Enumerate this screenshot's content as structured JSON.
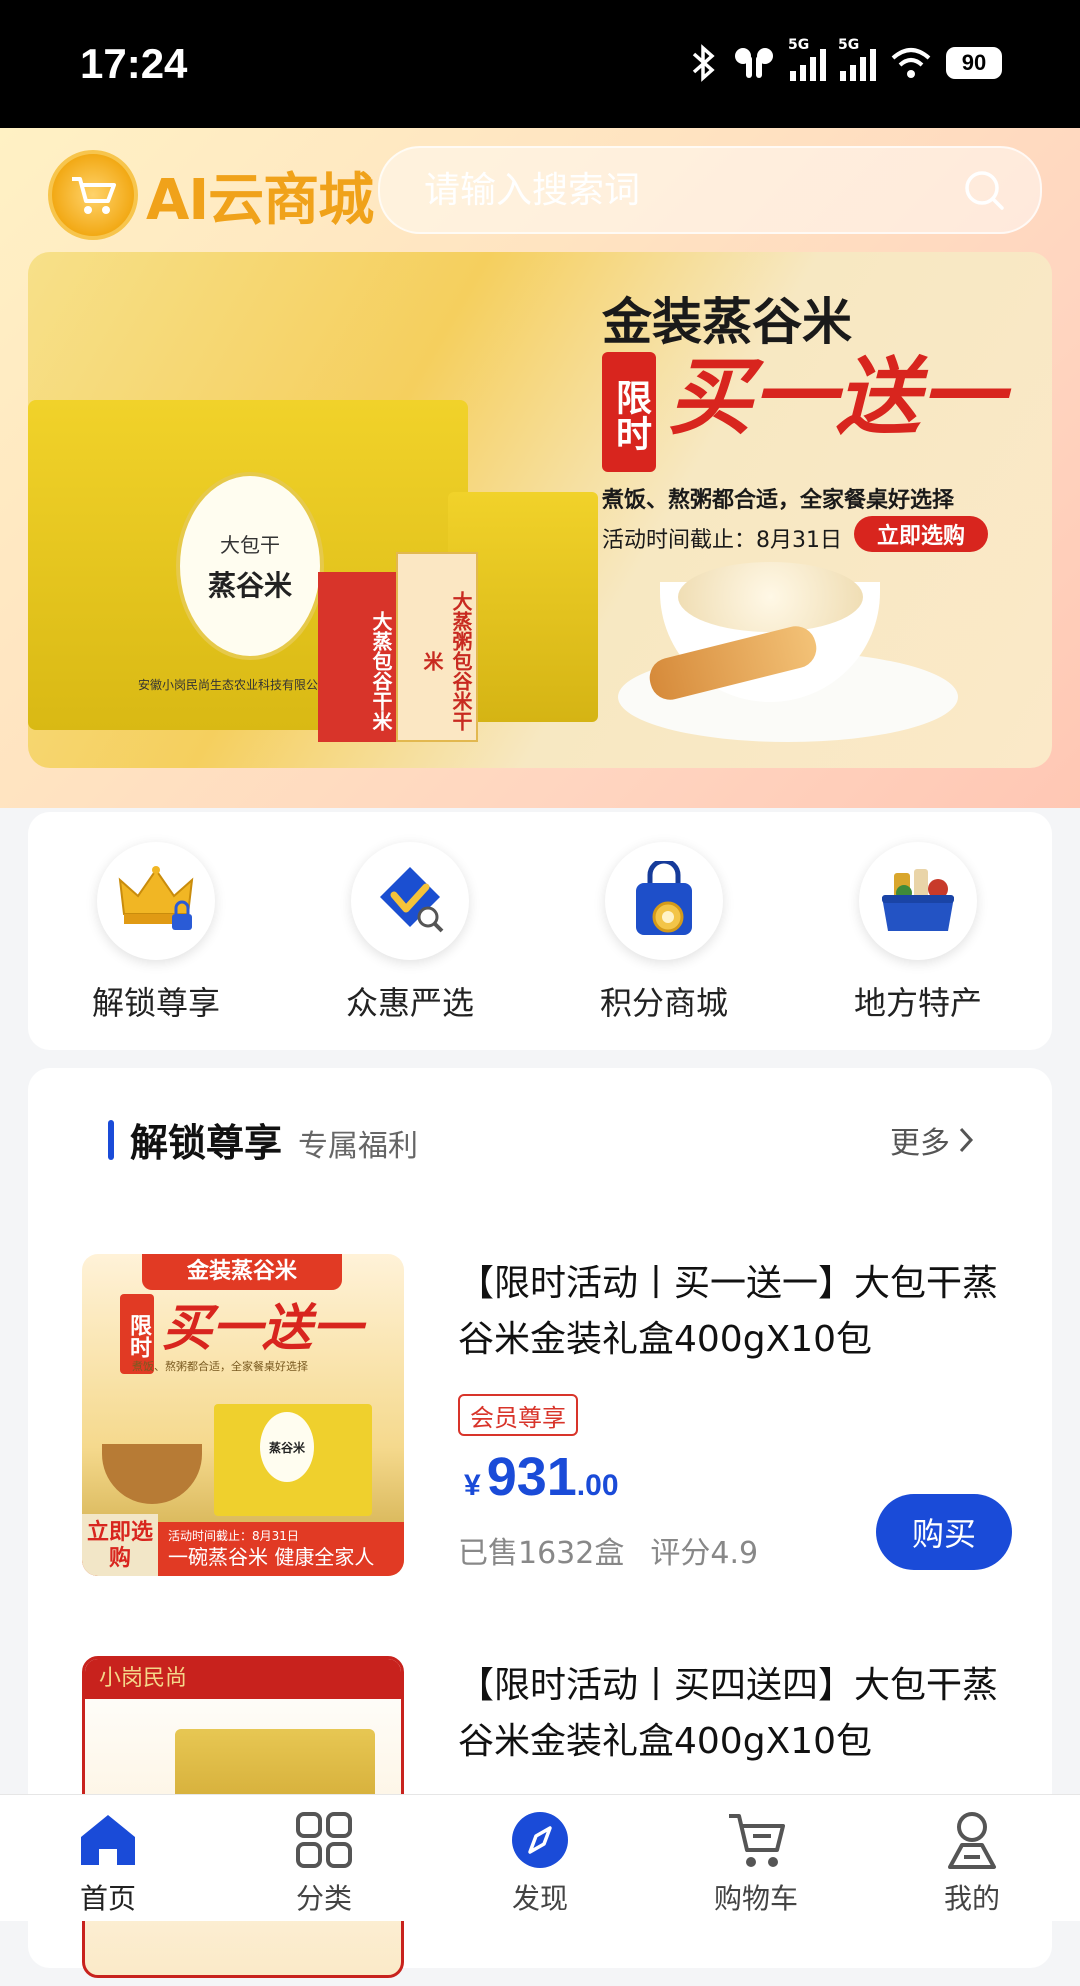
{
  "status_bar": {
    "time": "17:24",
    "battery": "90",
    "network1": "5G",
    "network2": "5G"
  },
  "app": {
    "logo_text": "AI云商城"
  },
  "search": {
    "placeholder": "请输入搜索词"
  },
  "banner": {
    "title": "金装蒸谷米",
    "limit_tag": "限时",
    "promo": "买一送一",
    "subtitle": "煮饭、熬粥都合适，全家餐桌好选择",
    "deadline": "活动时间截止：8月31日",
    "cta": "立即选购",
    "brand": "大包干",
    "product": "蒸谷米",
    "pack1": "大蒸包谷干米",
    "pack2": "大蒸粥包谷米干米",
    "company": "安徽小岗民尚生态农业科技有限公司"
  },
  "quick_entries": [
    {
      "label": "解锁尊享",
      "icon": "crown-lock-icon"
    },
    {
      "label": "众惠严选",
      "icon": "check-shield-icon"
    },
    {
      "label": "积分商城",
      "icon": "shopping-bag-coin-icon"
    },
    {
      "label": "地方特产",
      "icon": "food-basket-icon"
    }
  ],
  "section": {
    "title": "解锁尊享",
    "subtitle": "专属福利",
    "more": "更多"
  },
  "products": [
    {
      "title": "【限时活动丨买一送一】大包干蒸谷米金装礼盒400gX10包",
      "badge": "会员尊享",
      "currency": "¥",
      "price_int": "931",
      "price_dec": ".00",
      "sold": "已售1632盒",
      "rating": "评分4.9",
      "buy": "购买",
      "thumb": {
        "top": "金装蒸谷米",
        "limit": "限时",
        "promo": "买一送一",
        "line": "煮饭、熬粥都合适，全家餐桌好选择",
        "cta": "立即选购",
        "date": "活动时间截止：8月31日",
        "slogan": "一碗蒸谷米 健康全家人",
        "oval": "蒸谷米"
      }
    },
    {
      "title": "【限时活动丨买四送四】大包干蒸谷米金装礼盒400gX10包",
      "thumb": {
        "top": "小岗民尚"
      }
    }
  ],
  "tabbar": [
    {
      "label": "首页",
      "icon": "home-icon",
      "active": true
    },
    {
      "label": "分类",
      "icon": "grid-icon"
    },
    {
      "label": "发现",
      "icon": "compass-icon"
    },
    {
      "label": "购物车",
      "icon": "cart-icon"
    },
    {
      "label": "我的",
      "icon": "user-icon"
    }
  ],
  "colors": {
    "accent": "#1a4bd8",
    "promo_red": "#d8251e",
    "logo_gold": "#f0a21a"
  }
}
